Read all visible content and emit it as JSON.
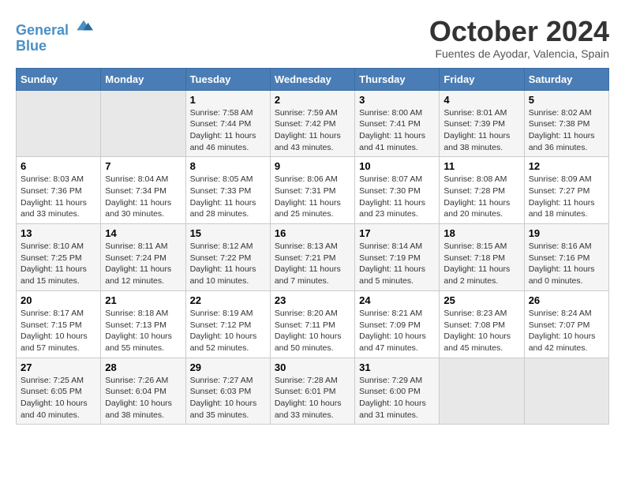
{
  "header": {
    "logo_line1": "General",
    "logo_line2": "Blue",
    "month_title": "October 2024",
    "location": "Fuentes de Ayodar, Valencia, Spain"
  },
  "weekdays": [
    "Sunday",
    "Monday",
    "Tuesday",
    "Wednesday",
    "Thursday",
    "Friday",
    "Saturday"
  ],
  "weeks": [
    [
      {
        "day": "",
        "empty": true
      },
      {
        "day": "",
        "empty": true
      },
      {
        "day": "1",
        "sunrise": "Sunrise: 7:58 AM",
        "sunset": "Sunset: 7:44 PM",
        "daylight": "Daylight: 11 hours and 46 minutes."
      },
      {
        "day": "2",
        "sunrise": "Sunrise: 7:59 AM",
        "sunset": "Sunset: 7:42 PM",
        "daylight": "Daylight: 11 hours and 43 minutes."
      },
      {
        "day": "3",
        "sunrise": "Sunrise: 8:00 AM",
        "sunset": "Sunset: 7:41 PM",
        "daylight": "Daylight: 11 hours and 41 minutes."
      },
      {
        "day": "4",
        "sunrise": "Sunrise: 8:01 AM",
        "sunset": "Sunset: 7:39 PM",
        "daylight": "Daylight: 11 hours and 38 minutes."
      },
      {
        "day": "5",
        "sunrise": "Sunrise: 8:02 AM",
        "sunset": "Sunset: 7:38 PM",
        "daylight": "Daylight: 11 hours and 36 minutes."
      }
    ],
    [
      {
        "day": "6",
        "sunrise": "Sunrise: 8:03 AM",
        "sunset": "Sunset: 7:36 PM",
        "daylight": "Daylight: 11 hours and 33 minutes."
      },
      {
        "day": "7",
        "sunrise": "Sunrise: 8:04 AM",
        "sunset": "Sunset: 7:34 PM",
        "daylight": "Daylight: 11 hours and 30 minutes."
      },
      {
        "day": "8",
        "sunrise": "Sunrise: 8:05 AM",
        "sunset": "Sunset: 7:33 PM",
        "daylight": "Daylight: 11 hours and 28 minutes."
      },
      {
        "day": "9",
        "sunrise": "Sunrise: 8:06 AM",
        "sunset": "Sunset: 7:31 PM",
        "daylight": "Daylight: 11 hours and 25 minutes."
      },
      {
        "day": "10",
        "sunrise": "Sunrise: 8:07 AM",
        "sunset": "Sunset: 7:30 PM",
        "daylight": "Daylight: 11 hours and 23 minutes."
      },
      {
        "day": "11",
        "sunrise": "Sunrise: 8:08 AM",
        "sunset": "Sunset: 7:28 PM",
        "daylight": "Daylight: 11 hours and 20 minutes."
      },
      {
        "day": "12",
        "sunrise": "Sunrise: 8:09 AM",
        "sunset": "Sunset: 7:27 PM",
        "daylight": "Daylight: 11 hours and 18 minutes."
      }
    ],
    [
      {
        "day": "13",
        "sunrise": "Sunrise: 8:10 AM",
        "sunset": "Sunset: 7:25 PM",
        "daylight": "Daylight: 11 hours and 15 minutes."
      },
      {
        "day": "14",
        "sunrise": "Sunrise: 8:11 AM",
        "sunset": "Sunset: 7:24 PM",
        "daylight": "Daylight: 11 hours and 12 minutes."
      },
      {
        "day": "15",
        "sunrise": "Sunrise: 8:12 AM",
        "sunset": "Sunset: 7:22 PM",
        "daylight": "Daylight: 11 hours and 10 minutes."
      },
      {
        "day": "16",
        "sunrise": "Sunrise: 8:13 AM",
        "sunset": "Sunset: 7:21 PM",
        "daylight": "Daylight: 11 hours and 7 minutes."
      },
      {
        "day": "17",
        "sunrise": "Sunrise: 8:14 AM",
        "sunset": "Sunset: 7:19 PM",
        "daylight": "Daylight: 11 hours and 5 minutes."
      },
      {
        "day": "18",
        "sunrise": "Sunrise: 8:15 AM",
        "sunset": "Sunset: 7:18 PM",
        "daylight": "Daylight: 11 hours and 2 minutes."
      },
      {
        "day": "19",
        "sunrise": "Sunrise: 8:16 AM",
        "sunset": "Sunset: 7:16 PM",
        "daylight": "Daylight: 11 hours and 0 minutes."
      }
    ],
    [
      {
        "day": "20",
        "sunrise": "Sunrise: 8:17 AM",
        "sunset": "Sunset: 7:15 PM",
        "daylight": "Daylight: 10 hours and 57 minutes."
      },
      {
        "day": "21",
        "sunrise": "Sunrise: 8:18 AM",
        "sunset": "Sunset: 7:13 PM",
        "daylight": "Daylight: 10 hours and 55 minutes."
      },
      {
        "day": "22",
        "sunrise": "Sunrise: 8:19 AM",
        "sunset": "Sunset: 7:12 PM",
        "daylight": "Daylight: 10 hours and 52 minutes."
      },
      {
        "day": "23",
        "sunrise": "Sunrise: 8:20 AM",
        "sunset": "Sunset: 7:11 PM",
        "daylight": "Daylight: 10 hours and 50 minutes."
      },
      {
        "day": "24",
        "sunrise": "Sunrise: 8:21 AM",
        "sunset": "Sunset: 7:09 PM",
        "daylight": "Daylight: 10 hours and 47 minutes."
      },
      {
        "day": "25",
        "sunrise": "Sunrise: 8:23 AM",
        "sunset": "Sunset: 7:08 PM",
        "daylight": "Daylight: 10 hours and 45 minutes."
      },
      {
        "day": "26",
        "sunrise": "Sunrise: 8:24 AM",
        "sunset": "Sunset: 7:07 PM",
        "daylight": "Daylight: 10 hours and 42 minutes."
      }
    ],
    [
      {
        "day": "27",
        "sunrise": "Sunrise: 7:25 AM",
        "sunset": "Sunset: 6:05 PM",
        "daylight": "Daylight: 10 hours and 40 minutes."
      },
      {
        "day": "28",
        "sunrise": "Sunrise: 7:26 AM",
        "sunset": "Sunset: 6:04 PM",
        "daylight": "Daylight: 10 hours and 38 minutes."
      },
      {
        "day": "29",
        "sunrise": "Sunrise: 7:27 AM",
        "sunset": "Sunset: 6:03 PM",
        "daylight": "Daylight: 10 hours and 35 minutes."
      },
      {
        "day": "30",
        "sunrise": "Sunrise: 7:28 AM",
        "sunset": "Sunset: 6:01 PM",
        "daylight": "Daylight: 10 hours and 33 minutes."
      },
      {
        "day": "31",
        "sunrise": "Sunrise: 7:29 AM",
        "sunset": "Sunset: 6:00 PM",
        "daylight": "Daylight: 10 hours and 31 minutes."
      },
      {
        "day": "",
        "empty": true
      },
      {
        "day": "",
        "empty": true
      }
    ]
  ]
}
